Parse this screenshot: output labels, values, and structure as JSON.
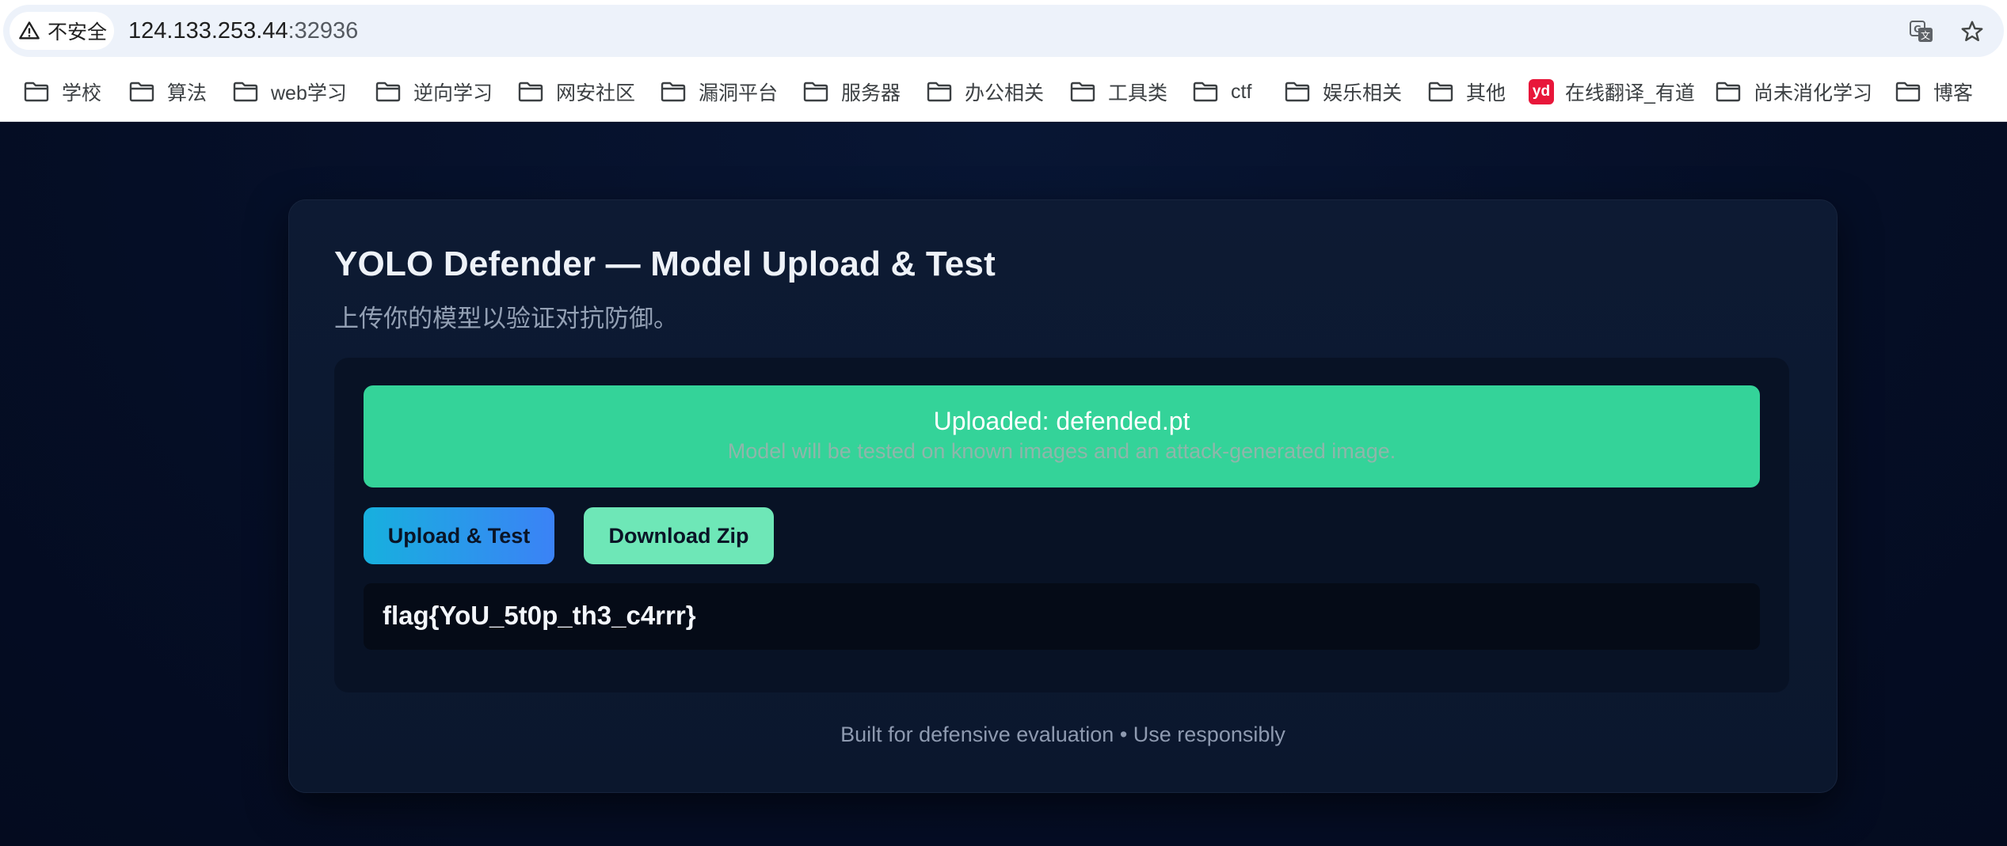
{
  "browser": {
    "security_label": "不安全",
    "url_host": "124.133.253.44",
    "url_port": ":32936",
    "icons": [
      "warning-icon",
      "translate-icon",
      "star-icon"
    ]
  },
  "bookmarks": [
    {
      "label": "学校",
      "icon": "folder-icon"
    },
    {
      "label": "算法",
      "icon": "folder-icon"
    },
    {
      "label": "web学习",
      "icon": "folder-icon"
    },
    {
      "label": "逆向学习",
      "icon": "folder-icon"
    },
    {
      "label": "网安社区",
      "icon": "folder-icon"
    },
    {
      "label": "漏洞平台",
      "icon": "folder-icon"
    },
    {
      "label": "服务器",
      "icon": "folder-icon"
    },
    {
      "label": "办公相关",
      "icon": "folder-icon"
    },
    {
      "label": "工具类",
      "icon": "folder-icon"
    },
    {
      "label": "ctf",
      "icon": "folder-icon"
    },
    {
      "label": "娱乐相关",
      "icon": "folder-icon"
    },
    {
      "label": "其他",
      "icon": "folder-icon"
    },
    {
      "label": "在线翻译_有道",
      "icon": "youdao-icon",
      "icon_text": "yd"
    },
    {
      "label": "尚未消化学习",
      "icon": "folder-icon"
    },
    {
      "label": "博客",
      "icon": "folder-icon"
    }
  ],
  "page": {
    "title": "YOLO Defender — Model Upload & Test",
    "subtitle": "上传你的模型以验证对抗防御。",
    "alert": {
      "title": "Uploaded: defended.pt",
      "detail": "Model will be tested on known images and an attack-generated image."
    },
    "buttons": {
      "upload": "Upload & Test",
      "download": "Download Zip"
    },
    "result": "flag{YoU_5t0p_th3_c4rrr}",
    "footer": "Built for defensive evaluation • Use responsibly"
  },
  "colors": {
    "background": "#050d24",
    "card": "#0d1a33",
    "success": "#34d399",
    "upload_gradient_start": "#17b0de",
    "upload_gradient_end": "#3b82f6",
    "download": "#6ee7b7"
  }
}
